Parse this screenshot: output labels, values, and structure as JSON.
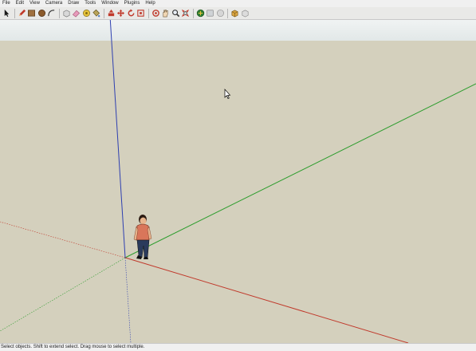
{
  "menu": {
    "items": [
      "File",
      "Edit",
      "View",
      "Camera",
      "Draw",
      "Tools",
      "Window",
      "Plugins",
      "Help"
    ]
  },
  "toolbar": {
    "tools": [
      {
        "name": "select-icon",
        "color": "#1a1a1a"
      },
      {
        "name": "pencil-icon",
        "color": "#c0392b"
      },
      {
        "name": "rectangle-icon",
        "color": "#8b5a2b"
      },
      {
        "name": "circle-icon",
        "color": "#7a4a2a"
      },
      {
        "name": "arc-icon",
        "color": "#555555"
      },
      {
        "name": "make-component-icon",
        "color": "#9a9a9a"
      },
      {
        "name": "eraser-icon",
        "color": "#e08fb0"
      },
      {
        "name": "tape-measure-icon",
        "color": "#c8a020"
      },
      {
        "name": "paint-bucket-icon",
        "color": "#8a7a30"
      },
      {
        "name": "push-pull-icon",
        "color": "#c0392b"
      },
      {
        "name": "move-icon",
        "color": "#c0392b"
      },
      {
        "name": "rotate-icon",
        "color": "#c0392b"
      },
      {
        "name": "offset-icon",
        "color": "#c0392b"
      },
      {
        "name": "orbit-icon",
        "color": "#c0392b"
      },
      {
        "name": "pan-icon",
        "color": "#d8b890"
      },
      {
        "name": "zoom-icon",
        "color": "#404040"
      },
      {
        "name": "zoom-extents-icon",
        "color": "#c0392b"
      },
      {
        "name": "get-models-icon",
        "color": "#2e7d32"
      },
      {
        "name": "share-model-icon",
        "color": "#9a9a9a"
      },
      {
        "name": "share-component-icon",
        "color": "#9a9a9a"
      },
      {
        "name": "extension-warehouse-icon",
        "color": "#b07d2a"
      },
      {
        "name": "extension-manager-icon",
        "color": "#9a9a9a"
      }
    ]
  },
  "colors": {
    "ground": "#d4d0bd",
    "sky": "#e8eeee",
    "axis_red": "#c0392b",
    "axis_green": "#2e9d2e",
    "axis_blue": "#2e3fb0"
  },
  "status": {
    "text": "Select objects. Shift to extend select. Drag mouse to select multiple."
  }
}
